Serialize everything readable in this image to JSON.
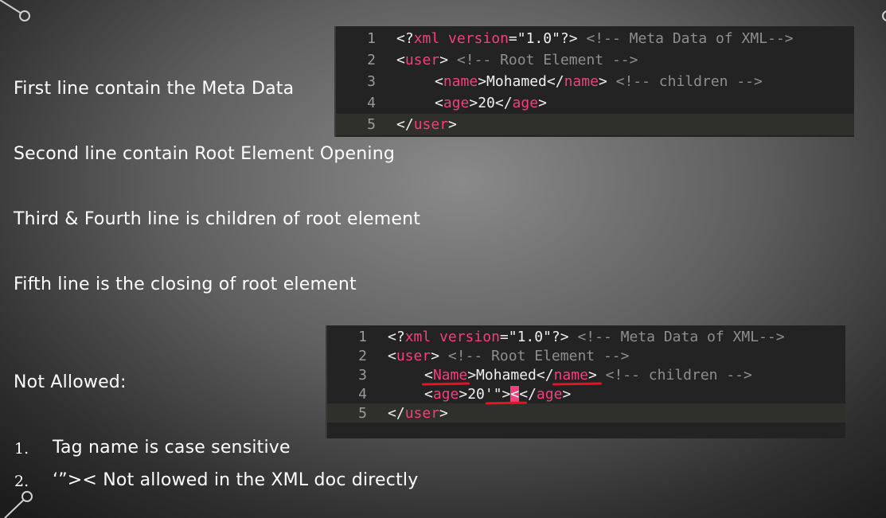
{
  "labels": {
    "line1": "First line contain the Meta Data",
    "line2": "Second line contain Root Element Opening",
    "line3": "Third & Fourth line is children of root element",
    "line4": "Fifth line is the closing of root element",
    "not_allowed": "Not Allowed:"
  },
  "rules": [
    {
      "number": "1.",
      "text": "Tag name is case sensitive"
    },
    {
      "number": "2.",
      "text": "‘”>< Not allowed in the XML doc directly"
    }
  ],
  "code_top": {
    "line_numbers": [
      "1",
      "2",
      "3",
      "4",
      "5"
    ]
  },
  "code_bottom": {
    "line_numbers": [
      "1",
      "2",
      "3",
      "4",
      "5"
    ]
  },
  "colors": {
    "tag": "#f0417a",
    "comment": "#8e8e8e",
    "error_underline": "#e8102a"
  }
}
